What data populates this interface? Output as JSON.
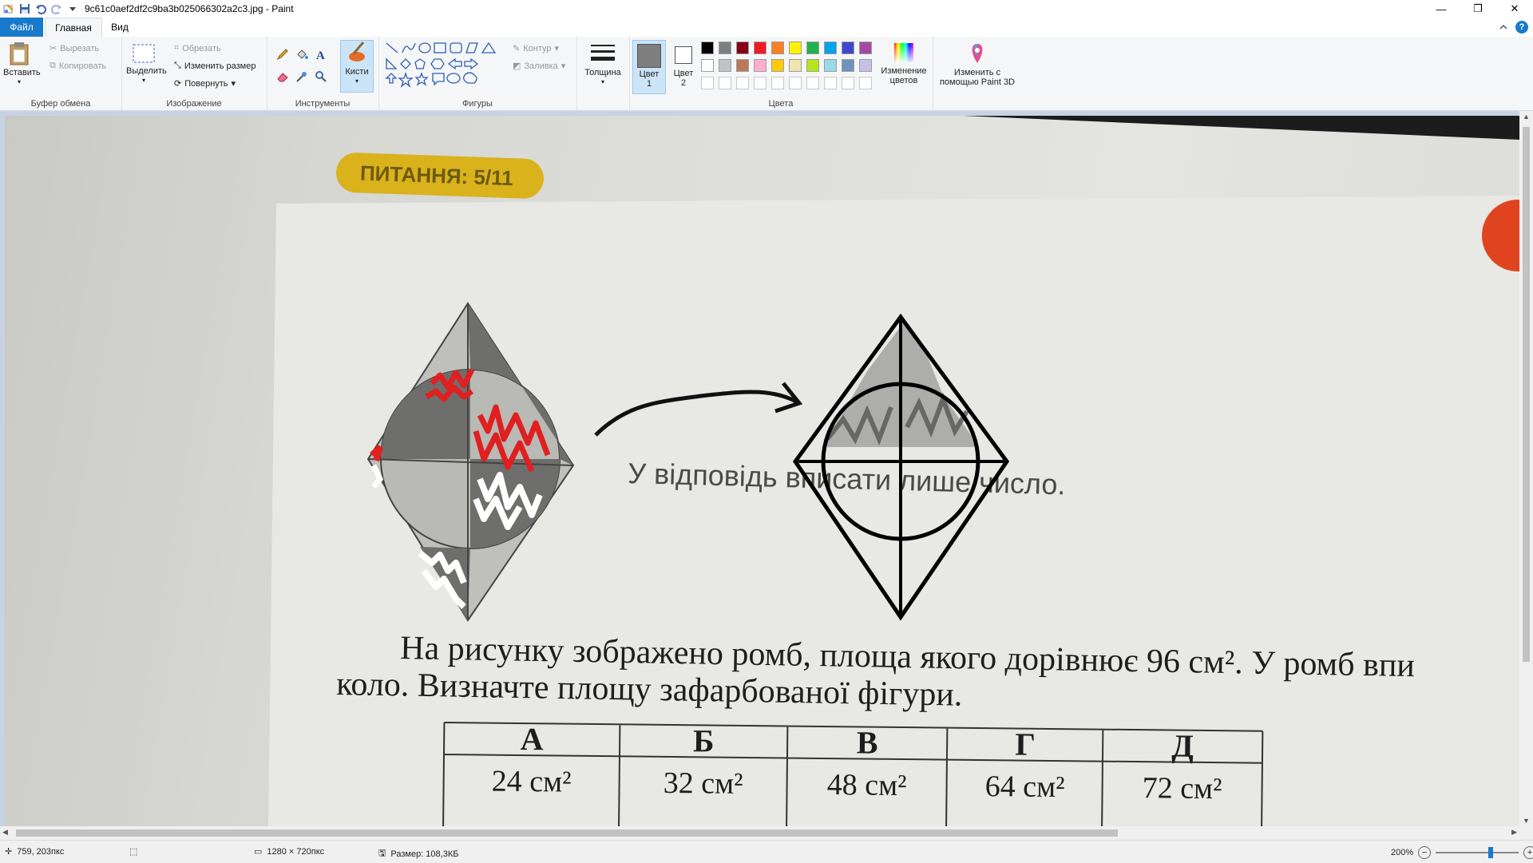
{
  "window": {
    "title": "9c61c0aef2df2c9ba3b025066302a2c3.jpg - Paint",
    "minimize": "—",
    "restore": "❐",
    "close": "✕"
  },
  "menu": {
    "file": "Файл",
    "home": "Главная",
    "view": "Вид",
    "help": "?"
  },
  "clipboard": {
    "paste": "Вставить",
    "cut": "Вырезать",
    "copy": "Копировать",
    "label": "Буфер обмена"
  },
  "image_group": {
    "select": "Выделить",
    "crop": "Обрезать",
    "resize": "Изменить размер",
    "rotate": "Повернуть",
    "label": "Изображение"
  },
  "tools": {
    "label": "Инструменты",
    "brushes": "Кисти"
  },
  "shapes": {
    "label": "Фигуры",
    "outline": "Контур",
    "fill": "Заливка"
  },
  "size": {
    "label": "Толщина"
  },
  "colors": {
    "color1": "Цвет",
    "color1_num": "1",
    "color2": "Цвет",
    "color2_num": "2",
    "label": "Цвета",
    "edit_line1": "Изменение",
    "edit_line2": "цветов",
    "palette_row1": [
      "#000000",
      "#7f7f7f",
      "#880015",
      "#ed1c24",
      "#ff7f27",
      "#fff200",
      "#22b14c",
      "#00a2e8",
      "#3f48cc",
      "#a349a4"
    ],
    "palette_row2": [
      "#ffffff",
      "#c3c3c3",
      "#b97a57",
      "#ffaec9",
      "#ffc90e",
      "#efe4b0",
      "#b5e61d",
      "#99d9ea",
      "#7092be",
      "#c8bfe7"
    ],
    "color1_value": "#7f7f7f",
    "color2_value": "#ffffff"
  },
  "paint3d": {
    "line1": "Изменить с",
    "line2": "помощью Paint 3D"
  },
  "canvas": {
    "badge": "ПИТАННЯ: 5/11",
    "answer_hint": "У відповідь вписати лише число.",
    "problem_line1": "На рисунку зображено ромб, площа якого дорівнює 96 см². У ромб впи",
    "problem_line2": "коло. Визначте площу зафарбованої фігури.",
    "table_headers": [
      "А",
      "Б",
      "В",
      "Г",
      "Д"
    ],
    "table_values": [
      "24 см²",
      "32 см²",
      "48 см²",
      "64 см²",
      "72 см²"
    ]
  },
  "status": {
    "cursor": "759, 203пкс",
    "dimensions": "1280 × 720пкс",
    "size": "Размер: 108,3КБ",
    "zoom": "200%"
  }
}
